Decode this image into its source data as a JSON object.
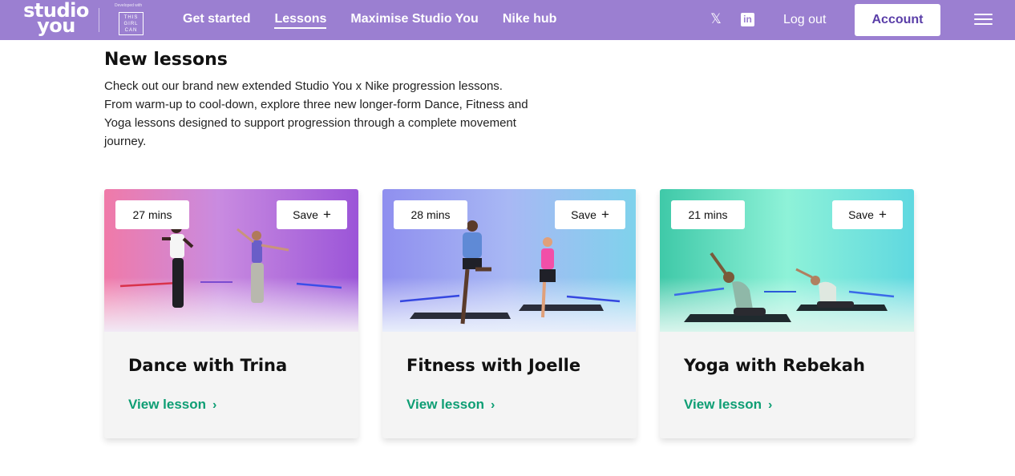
{
  "header": {
    "logo_line1": "studio",
    "logo_line2": "you",
    "partner_small": "Developed with",
    "partner_badge": "THIS GIRL CAN",
    "nav": [
      {
        "label": "Get started"
      },
      {
        "label": "Lessons"
      },
      {
        "label": "Maximise Studio You"
      },
      {
        "label": "Nike hub"
      }
    ],
    "active_nav": "Lessons",
    "social_x_icon": "x-icon",
    "social_linkedin_icon": "linkedin-icon",
    "logout_label": "Log out",
    "account_label": "Account",
    "menu_icon": "hamburger-menu-icon",
    "bg_color": "#9b7fd1"
  },
  "main": {
    "title": "New lessons",
    "intro_lines": [
      "Check out our brand new extended Studio You x Nike progression lessons.",
      "From warm-up to cool-down, explore three new longer-form Dance, Fitness and",
      "Yoga lessons designed to support progression through a complete movement",
      "journey."
    ]
  },
  "cards": [
    {
      "duration": "27 mins",
      "save_label": "Save",
      "title": "Dance with Trina",
      "link_label": "View lesson"
    },
    {
      "duration": "28 mins",
      "save_label": "Save",
      "title": "Fitness with Joelle",
      "link_label": "View lesson"
    },
    {
      "duration": "21 mins",
      "save_label": "Save",
      "title": "Yoga with Rebekah",
      "link_label": "View lesson"
    }
  ],
  "colors": {
    "link_green": "#0e9e74",
    "card_bg": "#f4f4f4"
  }
}
